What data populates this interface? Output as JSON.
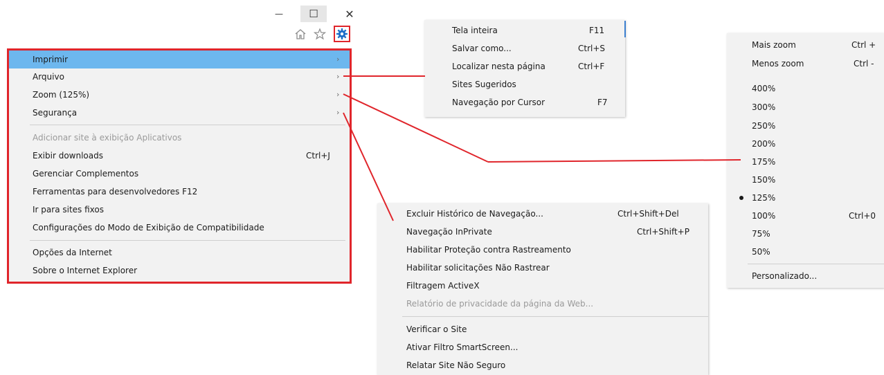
{
  "window_controls": {
    "minimize": "—",
    "maximize": "☐",
    "close": "✕"
  },
  "toolbar": {
    "home_icon": "home-icon",
    "favorites_icon": "star-icon",
    "tools_icon": "gear-icon"
  },
  "colors": {
    "highlight": "#6db7ee",
    "annotation_red": "#e0252b",
    "gear_blue": "#1e6fc9"
  },
  "tools_menu": {
    "items": [
      {
        "label": "Imprimir",
        "has_submenu": true,
        "highlighted": true
      },
      {
        "label": "Arquivo",
        "has_submenu": true
      },
      {
        "label": "Zoom (125%)",
        "has_submenu": true
      },
      {
        "label": "Segurança",
        "has_submenu": true
      },
      {
        "label": "Adicionar site à exibição Aplicativos",
        "disabled": true
      },
      {
        "label": "Exibir downloads",
        "shortcut": "Ctrl+J"
      },
      {
        "label": "Gerenciar Complementos"
      },
      {
        "label": "Ferramentas para desenvolvedores F12"
      },
      {
        "label": "Ir para sites fixos"
      },
      {
        "label": "Configurações do Modo de Exibição de Compatibilidade"
      },
      {
        "label": "Opções da Internet"
      },
      {
        "label": "Sobre o Internet Explorer"
      }
    ]
  },
  "file_menu": {
    "items": [
      {
        "label": "Tela inteira",
        "shortcut": "F11"
      },
      {
        "label": "Salvar como...",
        "shortcut": "Ctrl+S"
      },
      {
        "label": "Localizar nesta página",
        "shortcut": "Ctrl+F"
      },
      {
        "label": "Sites Sugeridos",
        "shortcut": ""
      },
      {
        "label": "Navegação por Cursor",
        "shortcut": "F7"
      }
    ]
  },
  "zoom_menu": {
    "items": [
      {
        "label": "Mais zoom",
        "shortcut": "Ctrl +"
      },
      {
        "label": "Menos zoom",
        "shortcut": "Ctrl -"
      },
      {
        "label": "400%"
      },
      {
        "label": "300%"
      },
      {
        "label": "250%"
      },
      {
        "label": "200%"
      },
      {
        "label": "175%"
      },
      {
        "label": "150%"
      },
      {
        "label": "125%",
        "selected": true
      },
      {
        "label": "100%",
        "shortcut": "Ctrl+0"
      },
      {
        "label": "75%"
      },
      {
        "label": "50%"
      },
      {
        "label": "Personalizado..."
      }
    ]
  },
  "security_menu": {
    "items": [
      {
        "label": "Excluir Histórico de Navegação...",
        "shortcut": "Ctrl+Shift+Del"
      },
      {
        "label": "Navegação InPrivate",
        "shortcut": "Ctrl+Shift+P"
      },
      {
        "label": "Habilitar Proteção contra Rastreamento"
      },
      {
        "label": "Habilitar solicitações Não Rastrear"
      },
      {
        "label": "Filtragem ActiveX"
      },
      {
        "label": "Relatório de privacidade da página da Web...",
        "disabled": true
      },
      {
        "label": "Verificar o Site"
      },
      {
        "label": "Ativar Filtro SmartScreen..."
      },
      {
        "label": "Relatar Site Não Seguro"
      }
    ]
  }
}
